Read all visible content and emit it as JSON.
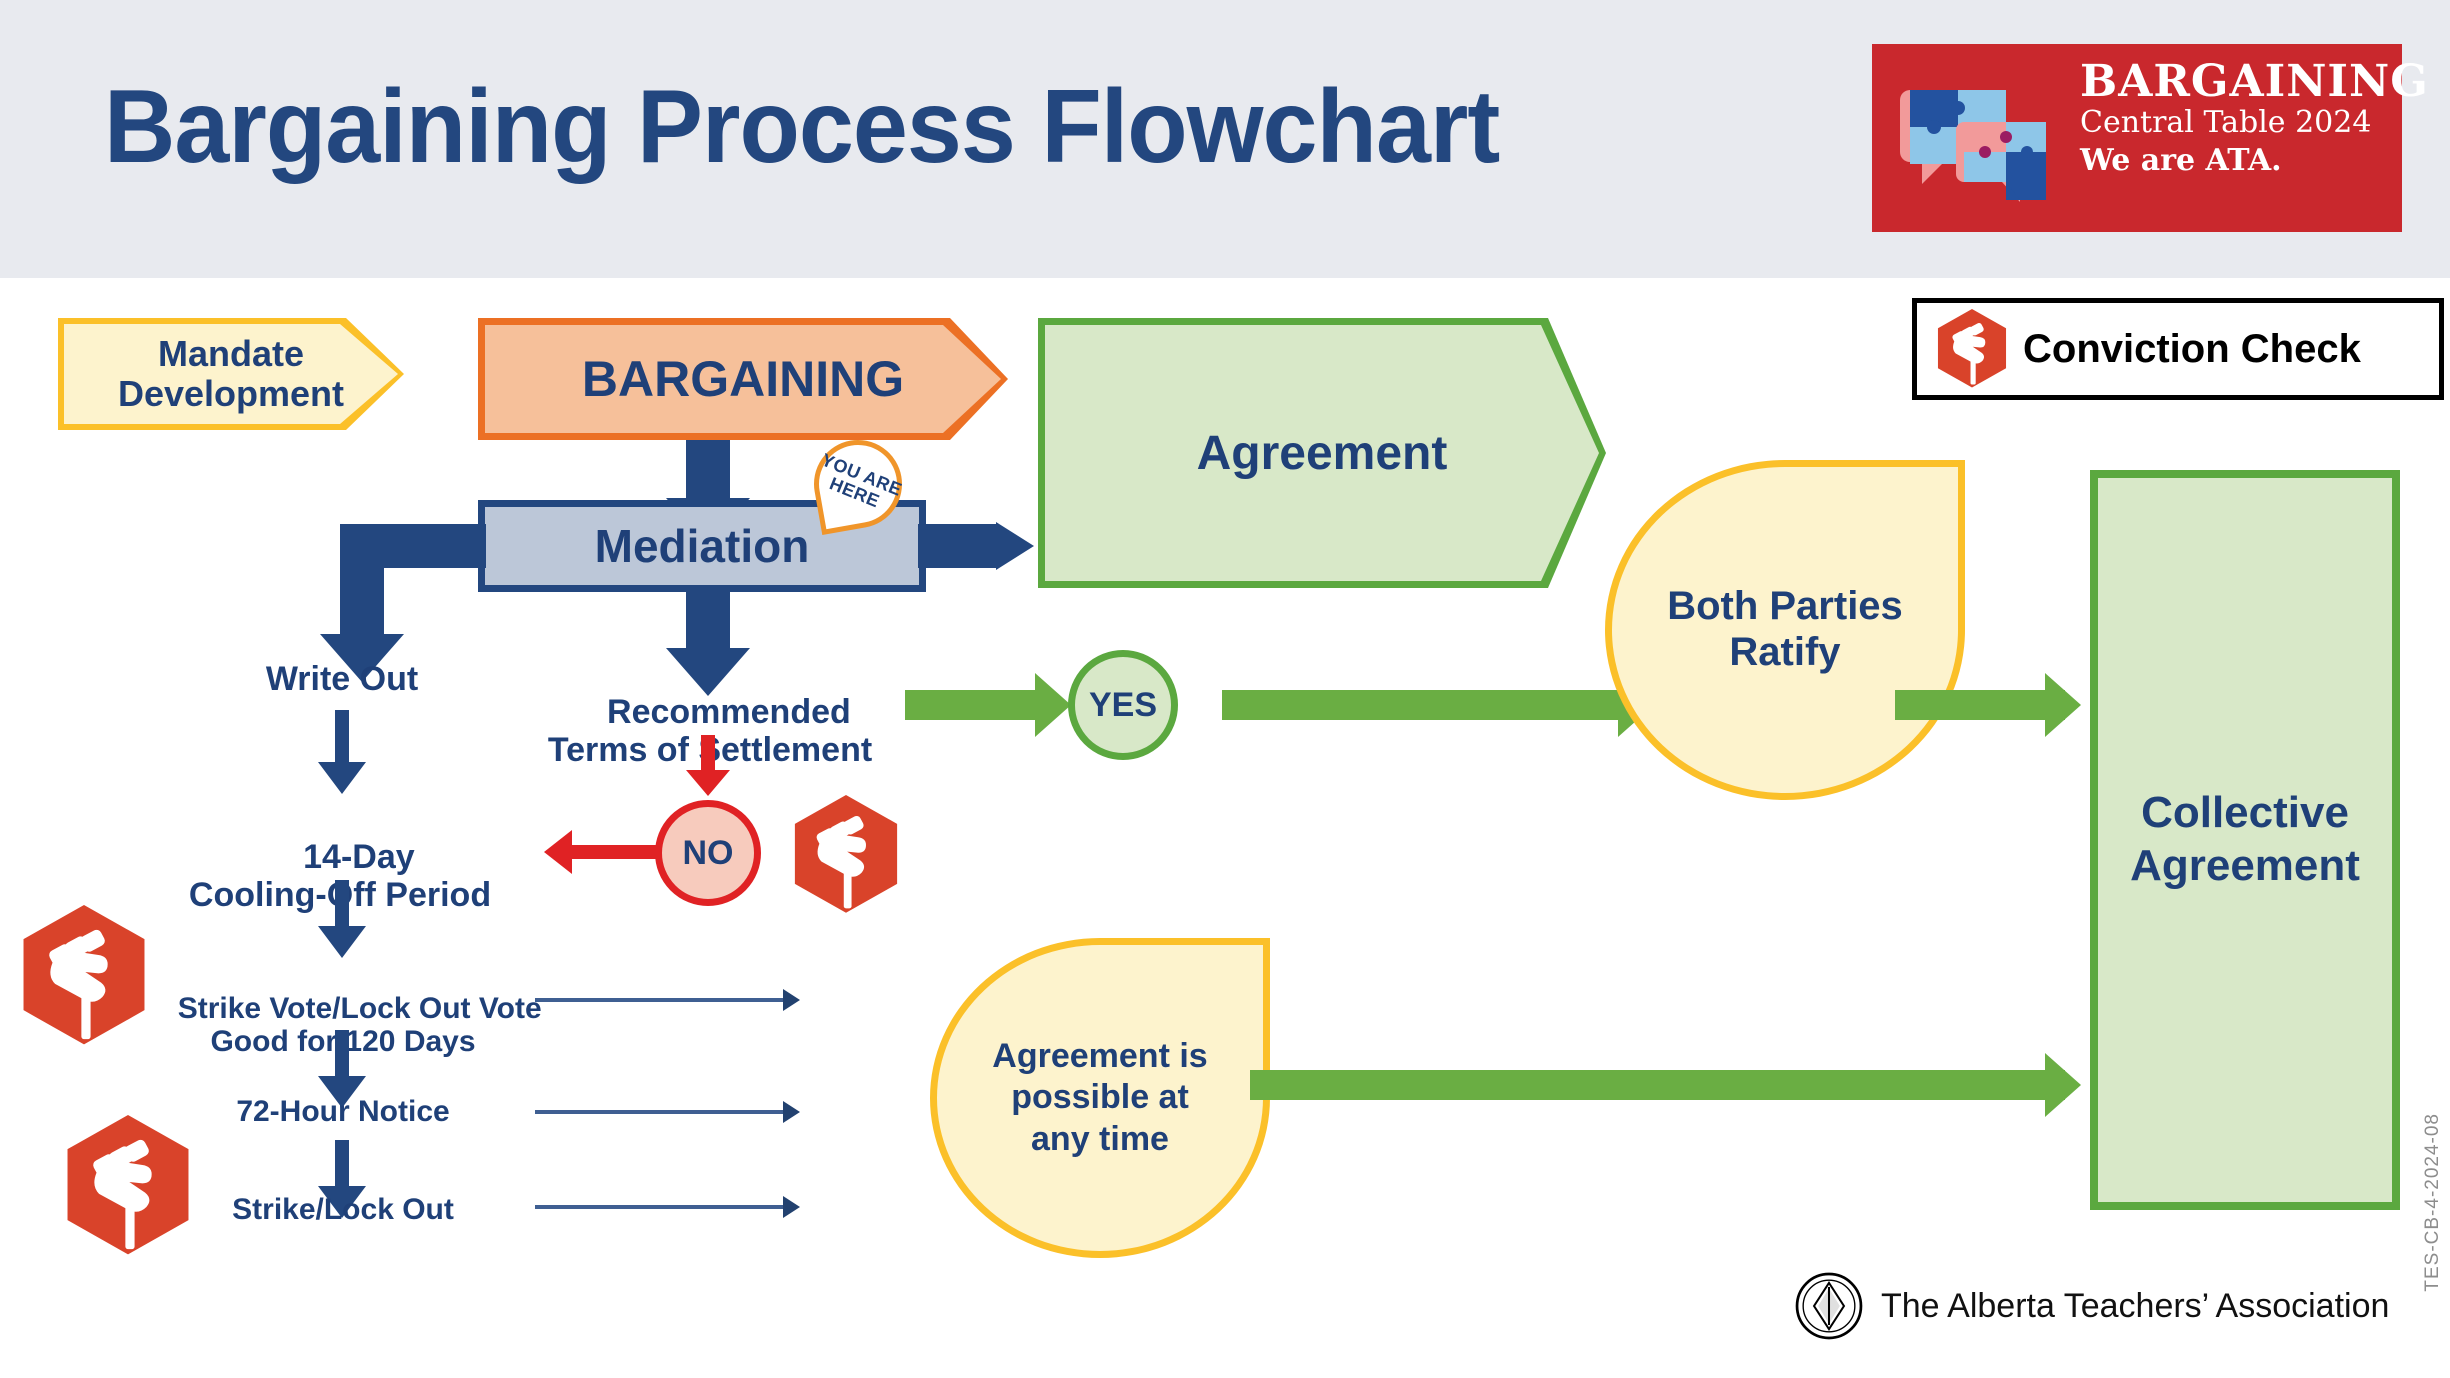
{
  "header": {
    "title": "Bargaining Process Flowchart",
    "background_color": "#e8eaef",
    "title_color": "#23477f"
  },
  "logo": {
    "line1": "BARGAINING",
    "line2": "Central Table 2024",
    "line3": "We are ATA.",
    "background_color": "#c9282d",
    "icon": "puzzle-speech-bubble-icon"
  },
  "legend": {
    "conviction_check_label": "Conviction Check",
    "icon": "raised-fist-icon",
    "icon_color": "#d9432a"
  },
  "nodes": {
    "mandate_development": "Mandate\nDevelopment",
    "bargaining": "BARGAINING",
    "mediation": "Mediation",
    "you_are_here_line1": "YOU ARE",
    "you_are_here_line2": "HERE",
    "agreement": "Agreement",
    "write_out": "Write Out",
    "recommended_terms": "Recommended\nTerms of Settlement",
    "yes": "YES",
    "no": "NO",
    "cooling_off": "14-Day\nCooling-Off Period",
    "strike_vote": "Strike Vote/Lock Out Vote\nGood for 120 Days",
    "notice_72": "72-Hour Notice",
    "strike_lockout": "Strike/Lock Out",
    "both_parties_ratify": "Both Parties\nRatify",
    "agreement_any_time": "Agreement is\npossible at\nany time",
    "collective_agreement": "Collective\nAgreement"
  },
  "colors": {
    "navy": "#1f4078",
    "navy_line": "#23477f",
    "yellow_fill": "#fdf3cd",
    "yellow_border": "#fbc029",
    "orange_fill": "#f6c09a",
    "orange_border": "#ec7024",
    "green_fill": "#d8e8c8",
    "green_border": "#5ba83f",
    "green_arrow": "#6aae43",
    "grey_blue_fill": "#bcc7d8",
    "red": "#e02224",
    "red_fill": "#f7cbbd",
    "fist_red": "#d9432a"
  },
  "footer": {
    "organization": "The Alberta Teachers’ Association",
    "document_code": "TES-CB-4-2024-08",
    "logo_icon": "ata-crest-icon"
  }
}
